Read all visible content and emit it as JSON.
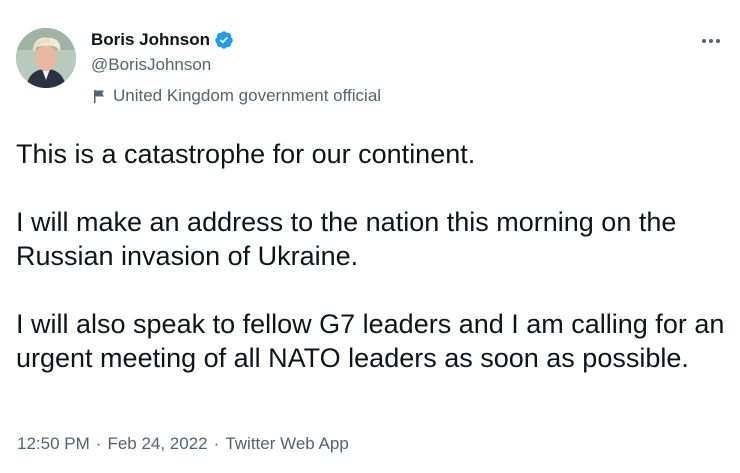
{
  "author": {
    "display_name": "Boris Johnson",
    "handle": "@BorisJohnson",
    "verified": true,
    "affiliation": "United Kingdom government official"
  },
  "menu_icon": "more-horizontal-icon",
  "tweet": {
    "paragraphs": [
      "This is a catastrophe for our continent.",
      "I will make an address to the nation this morning on the Russian invasion of Ukraine.",
      "I will also speak to fellow G7 leaders and I am calling for an urgent meeting of all NATO leaders as soon as possible."
    ]
  },
  "meta": {
    "time": "12:50 PM",
    "separator": "·",
    "date": "Feb 24, 2022",
    "source": "Twitter Web App"
  },
  "colors": {
    "text": "#0f1419",
    "secondary": "#536471",
    "verified": "#1d9bf0"
  }
}
